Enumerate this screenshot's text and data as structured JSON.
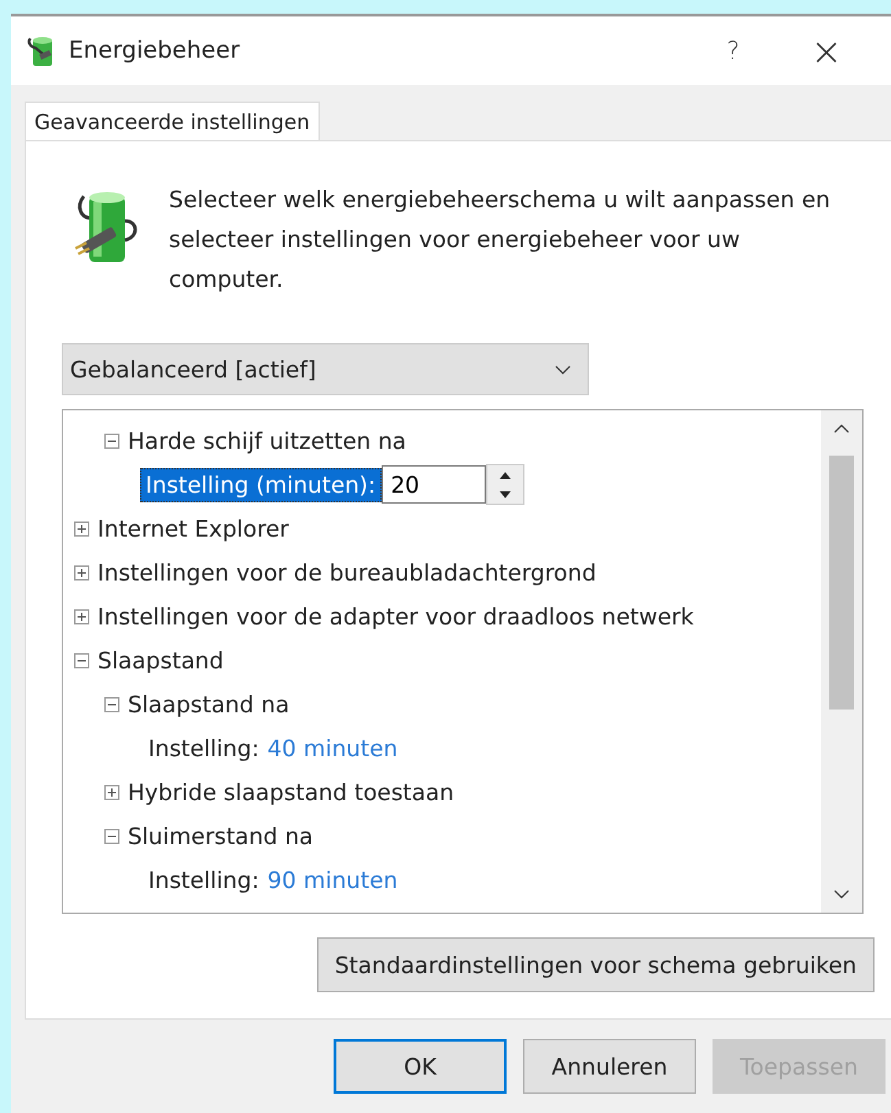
{
  "window": {
    "title": "Energiebeheer",
    "help": "?",
    "close": "×"
  },
  "tabs": [
    {
      "label": "Geavanceerde instellingen",
      "selected": true
    }
  ],
  "intro": "Selecteer welk energiebeheerschema u wilt aanpassen en selecteer instellingen voor energiebeheer voor uw computer.",
  "plan_dropdown": {
    "value": "Gebalanceerd [actief]"
  },
  "tree": [
    {
      "kind": "branch",
      "children": [
        {
          "kind": "branch",
          "label": "Harde schijf uitzetten na",
          "expanded": true,
          "children": [
            {
              "kind": "spin",
              "label": "Instelling (minuten):",
              "value": "20",
              "selected": true
            }
          ]
        }
      ]
    },
    {
      "kind": "branch",
      "label": "Internet Explorer",
      "expanded": false
    },
    {
      "kind": "branch",
      "label": "Instellingen voor de bureaubladachtergrond",
      "expanded": false
    },
    {
      "kind": "branch",
      "label": "Instellingen voor de adapter voor draadloos netwerk",
      "expanded": false
    },
    {
      "kind": "branch",
      "label": "Slaapstand",
      "expanded": true,
      "children": [
        {
          "kind": "branch",
          "label": "Slaapstand na",
          "expanded": true,
          "children": [
            {
              "kind": "setting",
              "label": "Instelling:",
              "value": "40 minuten"
            }
          ]
        },
        {
          "kind": "branch",
          "label": "Hybride slaapstand toestaan",
          "expanded": false
        },
        {
          "kind": "branch",
          "label": "Sluimerstand na",
          "expanded": true,
          "children": [
            {
              "kind": "setting",
              "label": "Instelling:",
              "value": "90 minuten"
            }
          ]
        }
      ]
    }
  ],
  "restore_button": "Standaardinstellingen voor schema gebruiken",
  "buttons": [
    {
      "label": "OK",
      "default": true,
      "disabled": false
    },
    {
      "label": "Annuleren",
      "default": false,
      "disabled": false
    },
    {
      "label": "Toepassen",
      "default": false,
      "disabled": true
    }
  ]
}
